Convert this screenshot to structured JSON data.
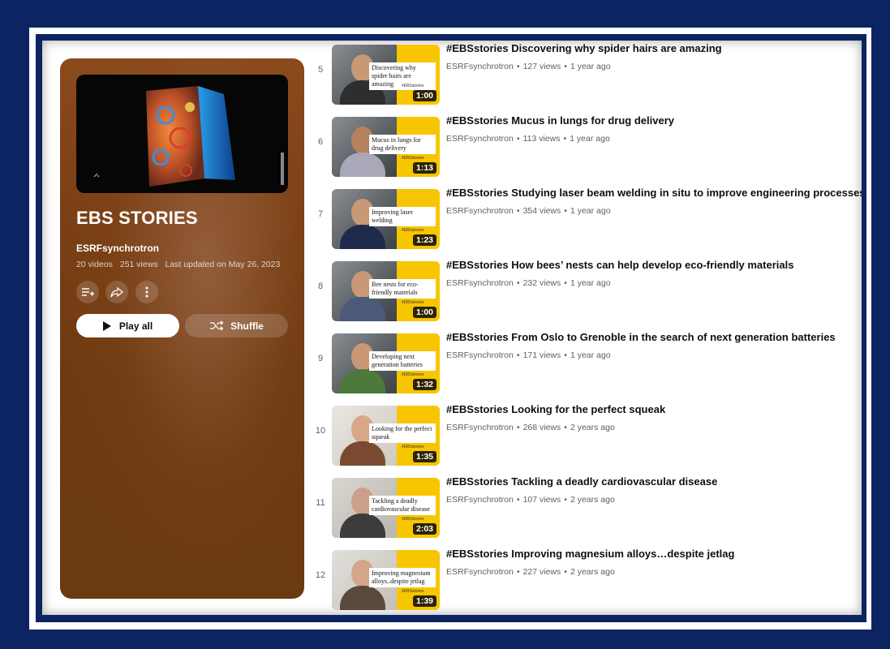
{
  "playlist": {
    "title": "EBS STORIES",
    "owner": "ESRFsynchrotron",
    "video_count": "20 videos",
    "views": "251 views",
    "updated": "Last updated on May 26, 2023",
    "play_all_label": "Play all",
    "shuffle_label": "Shuffle"
  },
  "icons": {
    "save": "add-to-queue-icon",
    "share": "share-icon",
    "more": "more-vert-icon",
    "play": "play-icon",
    "shuffle": "shuffle-icon"
  },
  "colors": {
    "panel": "#7a3f14",
    "frame": "#0d2462",
    "thumb_yellow": "#f7c600"
  },
  "videos": [
    {
      "index": "5",
      "title": "#EBSstories Discovering why spider hairs are amazing",
      "channel": "ESRFsynchrotron",
      "views": "127 views",
      "age": "1 year ago",
      "duration": "1:00",
      "thumb_text": "Discovering why spider hairs are amazing",
      "thumb_tag": "#EBSstories"
    },
    {
      "index": "6",
      "title": "#EBSstories Mucus in lungs for drug delivery",
      "channel": "ESRFsynchrotron",
      "views": "113 views",
      "age": "1 year ago",
      "duration": "1:13",
      "thumb_text": "Mucus in lungs for drug delivery",
      "thumb_tag": "#EBSstories"
    },
    {
      "index": "7",
      "title": "#EBSstories Studying laser beam welding in situ to improve engineering processes",
      "channel": "ESRFsynchrotron",
      "views": "354 views",
      "age": "1 year ago",
      "duration": "1:23",
      "thumb_text": "Improving laser welding",
      "thumb_tag": "#EBSstories"
    },
    {
      "index": "8",
      "title": "#EBSstories How bees’ nests can help develop eco-friendly materials",
      "channel": "ESRFsynchrotron",
      "views": "232 views",
      "age": "1 year ago",
      "duration": "1:00",
      "thumb_text": "Bee nests for eco-friendly materials",
      "thumb_tag": "#EBSstories"
    },
    {
      "index": "9",
      "title": "#EBSstories From Oslo to Grenoble in the search of next generation batteries",
      "channel": "ESRFsynchrotron",
      "views": "171 views",
      "age": "1 year ago",
      "duration": "1:32",
      "thumb_text": "Developing next generation batteries",
      "thumb_tag": "#EBSstories"
    },
    {
      "index": "10",
      "title": "#EBSstories Looking for the perfect squeak",
      "channel": "ESRFsynchrotron",
      "views": "268 views",
      "age": "2 years ago",
      "duration": "1:35",
      "thumb_text": "Looking for the perfect squeak",
      "thumb_tag": "#EBSstories"
    },
    {
      "index": "11",
      "title": "#EBSstories Tackling a deadly cardiovascular disease",
      "channel": "ESRFsynchrotron",
      "views": "107 views",
      "age": "2 years ago",
      "duration": "2:03",
      "thumb_text": "Tackling a deadly cardiovascular disease",
      "thumb_tag": "#EBSstories"
    },
    {
      "index": "12",
      "title": "#EBSstories Improving magnesium alloys…despite jetlag",
      "channel": "ESRFsynchrotron",
      "views": "227 views",
      "age": "2 years ago",
      "duration": "1:39",
      "thumb_text": "Improving magnesium alloys..despite jetlag",
      "thumb_tag": "#EBSstories"
    }
  ]
}
